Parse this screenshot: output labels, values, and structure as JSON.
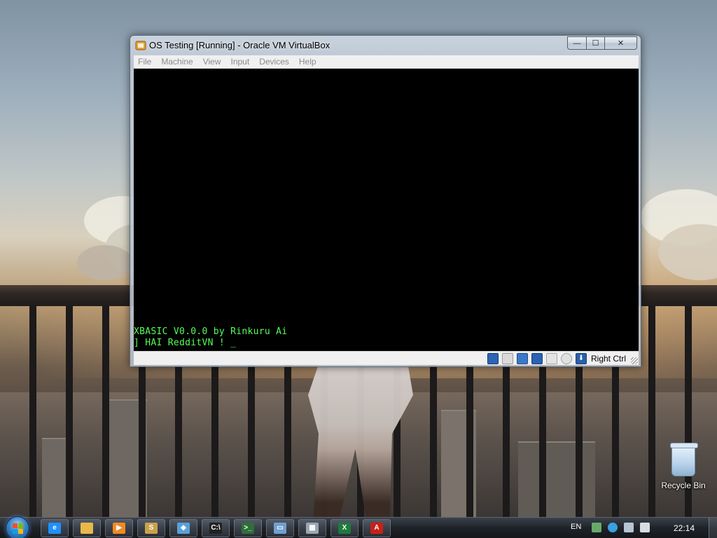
{
  "window": {
    "title": "OS Testing [Running] - Oracle VM VirtualBox",
    "minimize_glyph": "—",
    "maximize_glyph": "☐",
    "close_glyph": "✕",
    "menu": [
      "File",
      "Machine",
      "View",
      "Input",
      "Devices",
      "Help"
    ]
  },
  "console": {
    "line1": "XBASIC V0.0.0 by Rinkuru Ai",
    "line2": "] HAI RedditVN ! ",
    "cursor": "_",
    "text_color": "#55ff55",
    "background": "#000000"
  },
  "statusbar": {
    "icons": [
      "hard-disk-icon",
      "optical-drive-icon",
      "network-icon",
      "usb-icon",
      "shared-folders-icon",
      "remote-display-icon",
      "mouse-integration-icon"
    ],
    "host_key": "Right Ctrl"
  },
  "desktop": {
    "recycle_bin_label": "Recycle Bin"
  },
  "taskbar": {
    "pinned": [
      {
        "name": "internet-explorer-icon",
        "glyph": "e",
        "color": "#1e90ff"
      },
      {
        "name": "file-explorer-icon",
        "glyph": "",
        "color": "#e8b84a"
      },
      {
        "name": "media-player-icon",
        "glyph": "▶",
        "color": "#f08a24"
      },
      {
        "name": "sublime-text-icon",
        "glyph": "S",
        "color": "#c9a24a"
      },
      {
        "name": "virtualbox-icon",
        "glyph": "◆",
        "color": "#5aa0d8"
      },
      {
        "name": "command-prompt-icon",
        "glyph": "C:\\",
        "color": "#222222"
      },
      {
        "name": "terminal-icon",
        "glyph": ">_",
        "color": "#2f6f3a"
      },
      {
        "name": "window-app-icon",
        "glyph": "▭",
        "color": "#6fa0d0"
      },
      {
        "name": "calculator-icon",
        "glyph": "▦",
        "color": "#9aa6b2"
      },
      {
        "name": "excel-icon",
        "glyph": "X",
        "color": "#1f7a3c"
      },
      {
        "name": "acrobat-reader-icon",
        "glyph": "A",
        "color": "#c8201a"
      }
    ],
    "language": "EN",
    "clock": "22:14"
  }
}
